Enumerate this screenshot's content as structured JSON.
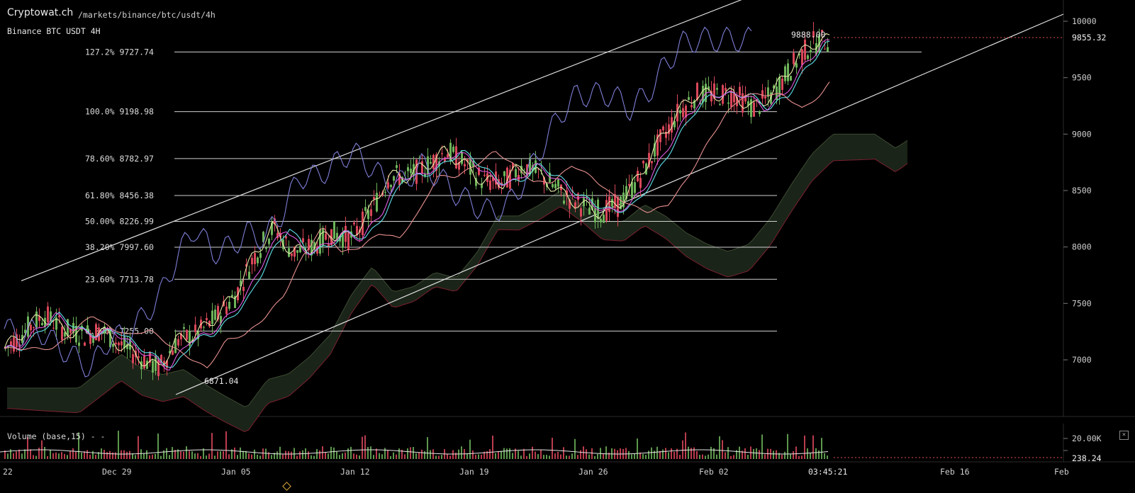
{
  "header": {
    "brand": "Cryptowat.ch",
    "path": "/markets/binance/btc/usdt/4h",
    "pair": "Binance BTC USDT 4H"
  },
  "volume_pane": {
    "title": "Volume (base,15) - -",
    "close_icon": "close-icon",
    "ticks": [
      "20.00K",
      "238.24"
    ]
  },
  "colors": {
    "background": "#000000",
    "up": "#6db35a",
    "down": "#d9475a",
    "cloud_bull": "#1a2418",
    "cloud_bear": "#3a0f17",
    "tenkan": "#e6e6a8",
    "kijun": "#5ee0e8",
    "lagging": "#7e7ed8",
    "ema_fast": "#e05ae0",
    "ema_slow": "#e89090",
    "fib": "#d0d0d0",
    "price_line": "#e05050"
  },
  "chart_data": {
    "type": "candlestick",
    "title": "Binance BTC USDT 4H",
    "ylim": [
      6650,
      10150
    ],
    "y_ticks": [
      7000,
      7500,
      8000,
      8500,
      9000,
      9500,
      10000
    ],
    "x_ticks": [
      "22",
      "Dec 29",
      "Jan 05",
      "Jan 12",
      "Jan 19",
      "Jan 26",
      "Feb 02",
      "Feb 16",
      "Feb"
    ],
    "last_price": "9855.32",
    "current_time": "03:45:21",
    "high_label": "9888.00",
    "low_label": "6871.04",
    "fibonacci": [
      {
        "pct": "127.2%",
        "price": "9727.74"
      },
      {
        "pct": "100.0%",
        "price": "9198.98"
      },
      {
        "pct": "78.60%",
        "price": "8782.97"
      },
      {
        "pct": "61.80%",
        "price": "8456.38"
      },
      {
        "pct": "50.00%",
        "price": "8226.99"
      },
      {
        "pct": "38.20%",
        "price": "7997.60"
      },
      {
        "pct": "23.60%",
        "price": "7713.78"
      },
      {
        "pct": "0.000%",
        "price": "7255.00"
      }
    ],
    "price_path": [
      [
        7050,
        7150
      ],
      [
        7200,
        7300
      ],
      [
        7350,
        7450
      ],
      [
        7250,
        7300
      ],
      [
        7200,
        7240
      ],
      [
        7250,
        7280
      ],
      [
        7150,
        7120
      ],
      [
        7050,
        7000
      ],
      [
        6900,
        6950
      ],
      [
        7100,
        7250
      ],
      [
        7250,
        7200
      ],
      [
        7300,
        7450
      ],
      [
        7500,
        7650
      ],
      [
        7800,
        8050
      ],
      [
        8200,
        8150
      ],
      [
        8000,
        7900
      ],
      [
        7950,
        8050
      ],
      [
        8100,
        8150
      ],
      [
        8100,
        8050
      ],
      [
        8200,
        8400
      ],
      [
        8550,
        8700
      ],
      [
        8650,
        8600
      ],
      [
        8700,
        8750
      ],
      [
        8800,
        8900
      ],
      [
        8750,
        8700
      ],
      [
        8650,
        8500
      ],
      [
        8550,
        8600
      ],
      [
        8700,
        8750
      ],
      [
        8650,
        8600
      ],
      [
        8500,
        8450
      ],
      [
        8400,
        8350
      ],
      [
        8300,
        8320
      ],
      [
        8350,
        8400
      ],
      [
        8500,
        8700
      ],
      [
        8800,
        9000
      ],
      [
        9100,
        9250
      ],
      [
        9300,
        9400
      ],
      [
        9350,
        9350
      ],
      [
        9400,
        9300
      ],
      [
        9250,
        9200
      ],
      [
        9300,
        9400
      ],
      [
        9500,
        9700
      ],
      [
        9750,
        9850
      ],
      [
        9820,
        9855
      ]
    ]
  }
}
